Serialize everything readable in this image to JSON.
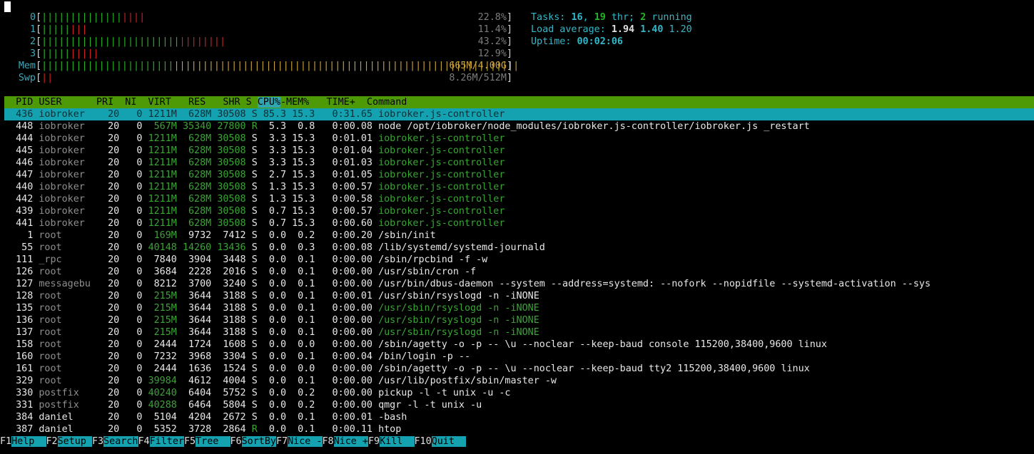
{
  "cpus": [
    {
      "label": "0",
      "green": "||||||||||||||",
      "red": "||||",
      "value": "22.8%"
    },
    {
      "label": "1",
      "green": "|||||",
      "red": "|||",
      "value": "11.4%"
    },
    {
      "label": "2",
      "green": "||||||||||||||||||||||||",
      "red": "||||||||",
      "value": "43.2%"
    },
    {
      "label": "3",
      "green": "|||||",
      "red": "|||||",
      "value": "12.9%"
    }
  ],
  "mem": {
    "label": "Mem",
    "green": "|||||||||||||||||||||||",
    "orange": "||||||||||||||||||||||||||||||||||||||||||||||||||||||||||||",
    "value": "665M/4.00G"
  },
  "swp": {
    "label": "Swp",
    "red": "||",
    "value": "8.26M/512M"
  },
  "stats": {
    "tasks_label": "Tasks: ",
    "tasks": "16",
    "thr": "19",
    "thr_label": " thr; ",
    "running": "2",
    "running_label": " running",
    "load_label": "Load average: ",
    "load1": "1.94",
    "load5": "1.40",
    "load15": "1.20",
    "uptime_label": "Uptime: ",
    "uptime": "00:02:06"
  },
  "header": {
    "pre": "  PID USER      PRI  NI  VIRT   RES   SHR S ",
    "sort": "CPU%",
    "post": "-MEM%   TIME+  Command"
  },
  "processes": [
    {
      "pid": "436",
      "user": "iobroker",
      "pri": "20",
      "ni": "0",
      "virt": "1211M",
      "res": "628M",
      "shr": "30508",
      "s": "S",
      "cpu": "85.3",
      "mem": "15.3",
      "time": "0:31.65",
      "cmd": "iobroker.js-controller",
      "thread": false
    },
    {
      "pid": "448",
      "user": "iobroker",
      "pri": "20",
      "ni": "0",
      "virt": "567M",
      "res": "35340",
      "shr": "27800",
      "s": "R",
      "cpu": "5.3",
      "mem": "0.8",
      "time": "0:00.08",
      "cmd": "node /opt/iobroker/node_modules/iobroker.js-controller/iobroker.js _restart",
      "thread": false
    },
    {
      "pid": "444",
      "user": "iobroker",
      "pri": "20",
      "ni": "0",
      "virt": "1211M",
      "res": "628M",
      "shr": "30508",
      "s": "S",
      "cpu": "3.3",
      "mem": "15.3",
      "time": "0:01.01",
      "cmd": "iobroker.js-controller",
      "thread": true
    },
    {
      "pid": "445",
      "user": "iobroker",
      "pri": "20",
      "ni": "0",
      "virt": "1211M",
      "res": "628M",
      "shr": "30508",
      "s": "S",
      "cpu": "3.3",
      "mem": "15.3",
      "time": "0:01.04",
      "cmd": "iobroker.js-controller",
      "thread": true
    },
    {
      "pid": "446",
      "user": "iobroker",
      "pri": "20",
      "ni": "0",
      "virt": "1211M",
      "res": "628M",
      "shr": "30508",
      "s": "S",
      "cpu": "3.3",
      "mem": "15.3",
      "time": "0:01.03",
      "cmd": "iobroker.js-controller",
      "thread": true
    },
    {
      "pid": "447",
      "user": "iobroker",
      "pri": "20",
      "ni": "0",
      "virt": "1211M",
      "res": "628M",
      "shr": "30508",
      "s": "S",
      "cpu": "2.7",
      "mem": "15.3",
      "time": "0:01.05",
      "cmd": "iobroker.js-controller",
      "thread": true
    },
    {
      "pid": "440",
      "user": "iobroker",
      "pri": "20",
      "ni": "0",
      "virt": "1211M",
      "res": "628M",
      "shr": "30508",
      "s": "S",
      "cpu": "1.3",
      "mem": "15.3",
      "time": "0:00.57",
      "cmd": "iobroker.js-controller",
      "thread": true
    },
    {
      "pid": "442",
      "user": "iobroker",
      "pri": "20",
      "ni": "0",
      "virt": "1211M",
      "res": "628M",
      "shr": "30508",
      "s": "S",
      "cpu": "1.3",
      "mem": "15.3",
      "time": "0:00.58",
      "cmd": "iobroker.js-controller",
      "thread": true
    },
    {
      "pid": "439",
      "user": "iobroker",
      "pri": "20",
      "ni": "0",
      "virt": "1211M",
      "res": "628M",
      "shr": "30508",
      "s": "S",
      "cpu": "0.7",
      "mem": "15.3",
      "time": "0:00.57",
      "cmd": "iobroker.js-controller",
      "thread": true
    },
    {
      "pid": "441",
      "user": "iobroker",
      "pri": "20",
      "ni": "0",
      "virt": "1211M",
      "res": "628M",
      "shr": "30508",
      "s": "S",
      "cpu": "0.7",
      "mem": "15.3",
      "time": "0:00.60",
      "cmd": "iobroker.js-controller",
      "thread": true
    },
    {
      "pid": "1",
      "user": "root",
      "pri": "20",
      "ni": "0",
      "virt": "169M",
      "res": "9732",
      "shr": "7412",
      "s": "S",
      "cpu": "0.0",
      "mem": "0.2",
      "time": "0:00.20",
      "cmd": "/sbin/init",
      "thread": false
    },
    {
      "pid": "55",
      "user": "root",
      "pri": "20",
      "ni": "0",
      "virt": "40148",
      "res": "14260",
      "shr": "13436",
      "s": "S",
      "cpu": "0.0",
      "mem": "0.3",
      "time": "0:00.08",
      "cmd": "/lib/systemd/systemd-journald",
      "thread": false
    },
    {
      "pid": "111",
      "user": "_rpc",
      "pri": "20",
      "ni": "0",
      "virt": "7840",
      "res": "3904",
      "shr": "3448",
      "s": "S",
      "cpu": "0.0",
      "mem": "0.1",
      "time": "0:00.00",
      "cmd": "/sbin/rpcbind -f -w",
      "thread": false
    },
    {
      "pid": "126",
      "user": "root",
      "pri": "20",
      "ni": "0",
      "virt": "3684",
      "res": "2228",
      "shr": "2016",
      "s": "S",
      "cpu": "0.0",
      "mem": "0.1",
      "time": "0:00.00",
      "cmd": "/usr/sbin/cron -f",
      "thread": false
    },
    {
      "pid": "127",
      "user": "messagebu",
      "pri": "20",
      "ni": "0",
      "virt": "8212",
      "res": "3700",
      "shr": "3240",
      "s": "S",
      "cpu": "0.0",
      "mem": "0.1",
      "time": "0:00.00",
      "cmd": "/usr/bin/dbus-daemon --system --address=systemd: --nofork --nopidfile --systemd-activation --sys",
      "thread": false
    },
    {
      "pid": "128",
      "user": "root",
      "pri": "20",
      "ni": "0",
      "virt": "215M",
      "res": "3644",
      "shr": "3188",
      "s": "S",
      "cpu": "0.0",
      "mem": "0.1",
      "time": "0:00.01",
      "cmd": "/usr/sbin/rsyslogd -n -iNONE",
      "thread": false
    },
    {
      "pid": "135",
      "user": "root",
      "pri": "20",
      "ni": "0",
      "virt": "215M",
      "res": "3644",
      "shr": "3188",
      "s": "S",
      "cpu": "0.0",
      "mem": "0.1",
      "time": "0:00.00",
      "cmd": "/usr/sbin/rsyslogd -n -iNONE",
      "thread": true
    },
    {
      "pid": "136",
      "user": "root",
      "pri": "20",
      "ni": "0",
      "virt": "215M",
      "res": "3644",
      "shr": "3188",
      "s": "S",
      "cpu": "0.0",
      "mem": "0.1",
      "time": "0:00.00",
      "cmd": "/usr/sbin/rsyslogd -n -iNONE",
      "thread": true
    },
    {
      "pid": "137",
      "user": "root",
      "pri": "20",
      "ni": "0",
      "virt": "215M",
      "res": "3644",
      "shr": "3188",
      "s": "S",
      "cpu": "0.0",
      "mem": "0.1",
      "time": "0:00.00",
      "cmd": "/usr/sbin/rsyslogd -n -iNONE",
      "thread": true
    },
    {
      "pid": "158",
      "user": "root",
      "pri": "20",
      "ni": "0",
      "virt": "2444",
      "res": "1724",
      "shr": "1608",
      "s": "S",
      "cpu": "0.0",
      "mem": "0.0",
      "time": "0:00.00",
      "cmd": "/sbin/agetty -o -p -- \\u --noclear --keep-baud console 115200,38400,9600 linux",
      "thread": false
    },
    {
      "pid": "160",
      "user": "root",
      "pri": "20",
      "ni": "0",
      "virt": "7232",
      "res": "3968",
      "shr": "3304",
      "s": "S",
      "cpu": "0.0",
      "mem": "0.1",
      "time": "0:00.04",
      "cmd": "/bin/login -p --",
      "thread": false
    },
    {
      "pid": "161",
      "user": "root",
      "pri": "20",
      "ni": "0",
      "virt": "2444",
      "res": "1636",
      "shr": "1524",
      "s": "S",
      "cpu": "0.0",
      "mem": "0.0",
      "time": "0:00.00",
      "cmd": "/sbin/agetty -o -p -- \\u --noclear --keep-baud tty2 115200,38400,9600 linux",
      "thread": false
    },
    {
      "pid": "329",
      "user": "root",
      "pri": "20",
      "ni": "0",
      "virt": "39984",
      "res": "4612",
      "shr": "4004",
      "s": "S",
      "cpu": "0.0",
      "mem": "0.1",
      "time": "0:00.00",
      "cmd": "/usr/lib/postfix/sbin/master -w",
      "thread": false
    },
    {
      "pid": "330",
      "user": "postfix",
      "pri": "20",
      "ni": "0",
      "virt": "40240",
      "res": "6404",
      "shr": "5752",
      "s": "S",
      "cpu": "0.0",
      "mem": "0.2",
      "time": "0:00.00",
      "cmd": "pickup -l -t unix -u -c",
      "thread": false
    },
    {
      "pid": "331",
      "user": "postfix",
      "pri": "20",
      "ni": "0",
      "virt": "40288",
      "res": "6464",
      "shr": "5804",
      "s": "S",
      "cpu": "0.0",
      "mem": "0.2",
      "time": "0:00.00",
      "cmd": "qmgr -l -t unix -u",
      "thread": false
    },
    {
      "pid": "384",
      "user": "daniel",
      "pri": "20",
      "ni": "0",
      "virt": "5104",
      "res": "4204",
      "shr": "2672",
      "s": "S",
      "cpu": "0.0",
      "mem": "0.1",
      "time": "0:00.01",
      "cmd": "-bash",
      "thread": false
    },
    {
      "pid": "387",
      "user": "daniel",
      "pri": "20",
      "ni": "0",
      "virt": "5352",
      "res": "3728",
      "shr": "2864",
      "s": "R",
      "cpu": "0.0",
      "mem": "0.1",
      "time": "0:00.11",
      "cmd": "htop",
      "thread": false
    }
  ],
  "selected_index": 0,
  "fkeys": [
    {
      "key": "F1",
      "label": "Help  "
    },
    {
      "key": "F2",
      "label": "Setup "
    },
    {
      "key": "F3",
      "label": "Search"
    },
    {
      "key": "F4",
      "label": "Filter"
    },
    {
      "key": "F5",
      "label": "Tree  "
    },
    {
      "key": "F6",
      "label": "SortBy"
    },
    {
      "key": "F7",
      "label": "Nice -"
    },
    {
      "key": "F8",
      "label": "Nice +"
    },
    {
      "key": "F9",
      "label": "Kill  "
    },
    {
      "key": "F10",
      "label": "Quit  "
    }
  ],
  "colors": {
    "header_bg": "#4e9a06",
    "selection_bg": "#14a2b0",
    "thread_fg": "#3aa435",
    "meter_green": "#26b523",
    "meter_red": "#cc2222",
    "meter_orange": "#c8a13c",
    "accent_cyan": "#34b7c8"
  }
}
